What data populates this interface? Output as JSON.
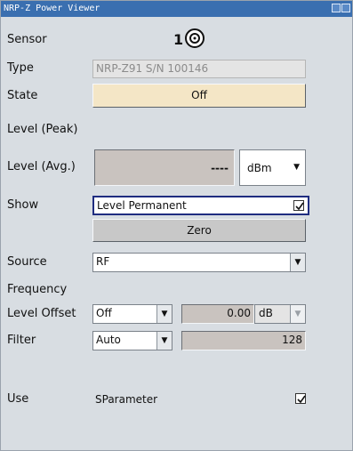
{
  "window": {
    "title": "NRP-Z Power Viewer"
  },
  "sensor": {
    "label": "Sensor",
    "value": "1",
    "icon": "sensor-connector-icon"
  },
  "type": {
    "label": "Type",
    "value": "NRP-Z91 S/N 100146"
  },
  "state": {
    "label": "State",
    "value": "Off"
  },
  "level_peak": {
    "label": "Level (Peak)"
  },
  "level_avg": {
    "label": "Level (Avg.)",
    "value": "----",
    "unit": "dBm"
  },
  "show": {
    "label": "Show",
    "value": "Level Permanent",
    "checked": true
  },
  "zero": {
    "label": "Zero"
  },
  "source": {
    "label": "Source",
    "value": "RF"
  },
  "frequency": {
    "label": "Frequency"
  },
  "level_offset": {
    "label": "Level Offset",
    "mode": "Off",
    "value": "0.00",
    "unit": "dB"
  },
  "filter": {
    "label": "Filter",
    "mode": "Auto",
    "value": "128"
  },
  "use": {
    "label": "Use",
    "value": "SParameter",
    "checked": true
  },
  "colors": {
    "title_bar": "#3a6fb0",
    "state_button": "#f4e6c6",
    "panel": "#d8dde2",
    "readonly": "#c9c3bf",
    "focus_border": "#1f2d80"
  }
}
